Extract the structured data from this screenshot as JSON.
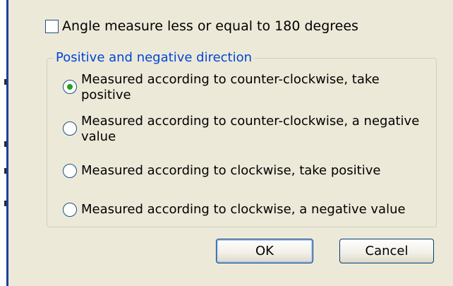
{
  "dialog": {
    "checkbox": {
      "label": "Angle measure less or equal to 180 degrees",
      "checked": false
    },
    "direction_group": {
      "title": "Positive and negative direction",
      "options": [
        {
          "label": "Measured according to counter-clockwise, take positive",
          "selected": true
        },
        {
          "label": "Measured according to counter-clockwise, a negative value",
          "selected": false
        },
        {
          "label": "Measured according to clockwise, take positive",
          "selected": false
        },
        {
          "label": "Measured according to clockwise, a negative value",
          "selected": false
        }
      ]
    },
    "buttons": {
      "ok_label": "OK",
      "cancel_label": "Cancel"
    }
  },
  "colors": {
    "dialog_background": "#ece9d8",
    "group_title": "#0046d5",
    "radio_selected_dot": "#21a121",
    "frame_border": "#1c3f9b"
  }
}
